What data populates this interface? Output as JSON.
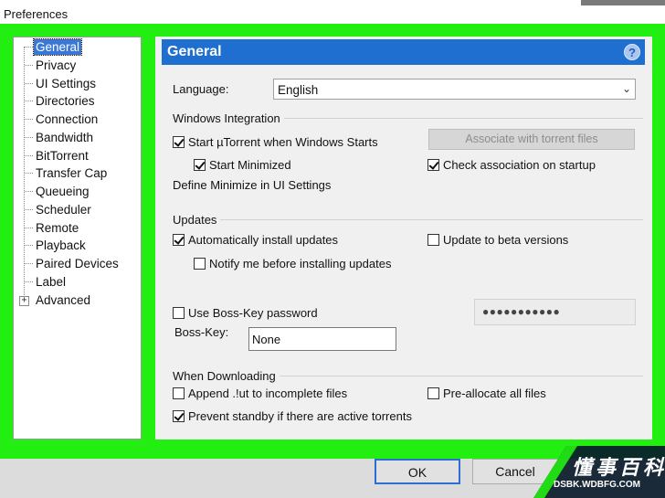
{
  "window": {
    "title": "Preferences"
  },
  "sidebar": {
    "items": [
      {
        "label": "General",
        "selected": true
      },
      {
        "label": "Privacy"
      },
      {
        "label": "UI Settings"
      },
      {
        "label": "Directories"
      },
      {
        "label": "Connection"
      },
      {
        "label": "Bandwidth"
      },
      {
        "label": "BitTorrent"
      },
      {
        "label": "Transfer Cap"
      },
      {
        "label": "Queueing"
      },
      {
        "label": "Scheduler"
      },
      {
        "label": "Remote"
      },
      {
        "label": "Playback"
      },
      {
        "label": "Paired Devices"
      },
      {
        "label": "Label"
      },
      {
        "label": "Advanced",
        "expandable": true
      }
    ],
    "expander_symbol": "+"
  },
  "panel": {
    "title": "General",
    "help_symbol": "?",
    "language": {
      "label": "Language:",
      "value": "English"
    },
    "windows_integration": {
      "title": "Windows Integration",
      "start_label": "Start µTorrent when Windows Starts",
      "start_checked": true,
      "minimized_label": "Start Minimized",
      "minimized_checked": true,
      "define_minimize": "Define Minimize in UI Settings",
      "associate_button": "Associate with torrent files",
      "check_assoc_label": "Check association on startup",
      "check_assoc_checked": true
    },
    "updates": {
      "title": "Updates",
      "auto_install_label": "Automatically install updates",
      "auto_install_checked": true,
      "beta_label": "Update to beta versions",
      "beta_checked": false,
      "notify_label": "Notify me before installing updates",
      "notify_checked": false
    },
    "boss_key": {
      "password_label": "Use Boss-Key password",
      "password_checked": false,
      "password_value": "●●●●●●●●●●●",
      "key_label": "Boss-Key:",
      "key_value": "None"
    },
    "downloading": {
      "title": "When Downloading",
      "append_label": "Append .!ut to incomplete files",
      "append_checked": false,
      "preallocate_label": "Pre-allocate all files",
      "preallocate_checked": false,
      "prevent_standby_label": "Prevent standby if there are active torrents",
      "prevent_standby_checked": true
    }
  },
  "buttons": {
    "ok": "OK",
    "cancel": "Cancel"
  },
  "watermark": {
    "main": "懂事百科",
    "sub": "DSBK.WDBFG.COM"
  },
  "colors": {
    "highlight": "#22ee11",
    "header": "#1e6fd0",
    "selection": "#3a78d8"
  }
}
